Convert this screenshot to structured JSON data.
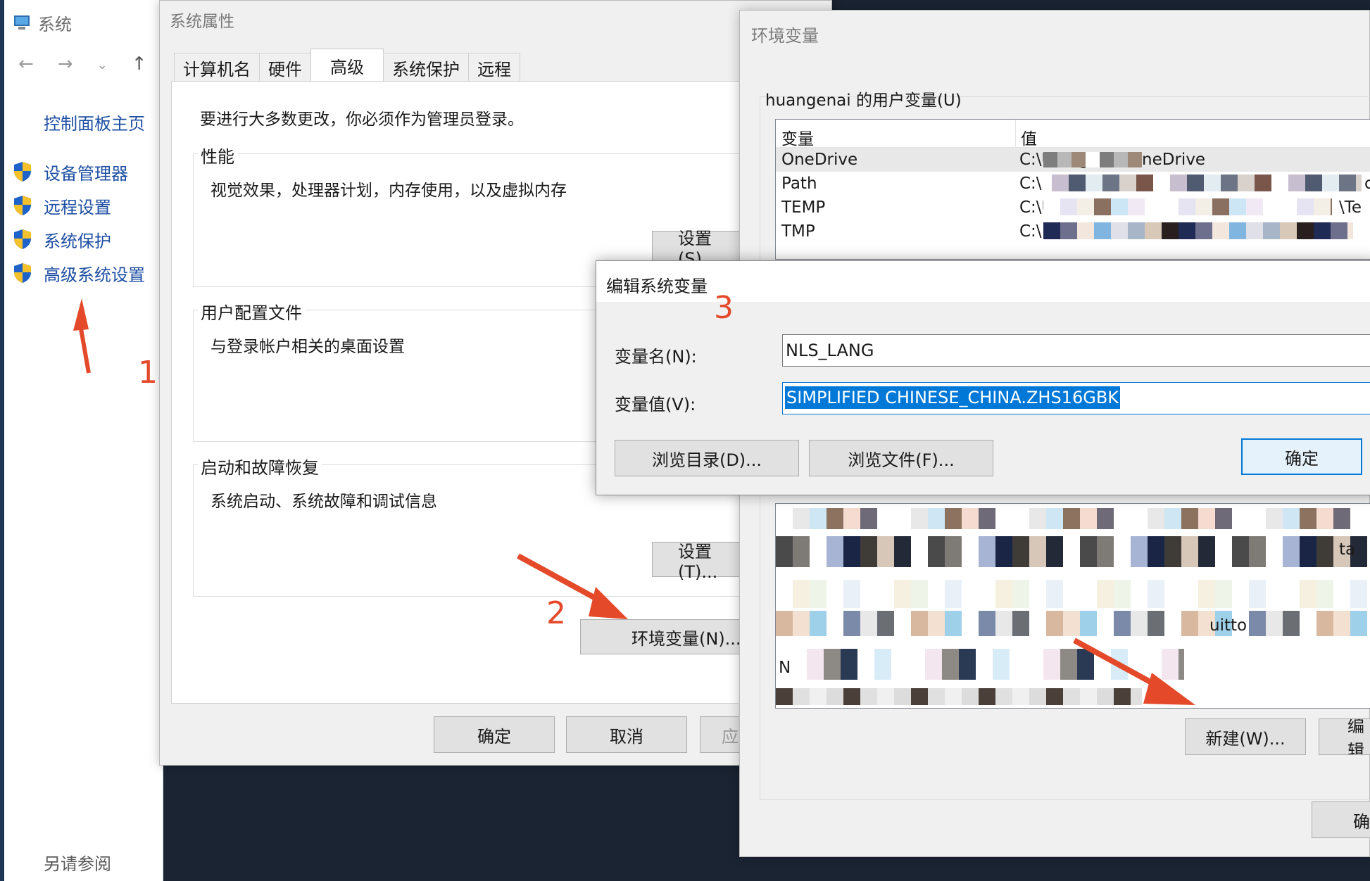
{
  "system_window": {
    "title": "系统",
    "nav": {
      "back": "←",
      "forward": "→",
      "recent": "⌄",
      "up": "↑"
    },
    "home_link": "控制面板主页",
    "links": [
      {
        "label": "设备管理器",
        "icon": "shield-icon"
      },
      {
        "label": "远程设置",
        "icon": "shield-icon"
      },
      {
        "label": "系统保护",
        "icon": "shield-icon"
      },
      {
        "label": "高级系统设置",
        "icon": "shield-icon"
      }
    ],
    "see_also": "另请参阅"
  },
  "system_properties": {
    "title": "系统属性",
    "tabs": [
      "计算机名",
      "硬件",
      "高级",
      "系统保护",
      "远程"
    ],
    "active_tab": "高级",
    "admin_note": "要进行大多数更改，你必须作为管理员登录。",
    "performance": {
      "label": "性能",
      "description": "视觉效果，处理器计划，内存使用，以及虚拟内存",
      "button": "设置(S)..."
    },
    "user_profiles": {
      "label": "用户配置文件",
      "description": "与登录帐户相关的桌面设置"
    },
    "startup_recovery": {
      "label": "启动和故障恢复",
      "description": "系统启动、系统故障和调试信息",
      "button": "设置(T)..."
    },
    "env_button": "环境变量(N)...",
    "ok": "确定",
    "cancel": "取消",
    "apply_partial": "应"
  },
  "env_vars": {
    "title": "环境变量",
    "user_section_label": "huangenai 的用户变量(U)",
    "columns": {
      "name": "变量",
      "value": "值"
    },
    "user_rows": [
      {
        "name": "OneDrive",
        "value": "C:\\U          angenai\\OneDrive"
      },
      {
        "name": "Path",
        "value": "C:\\"
      },
      {
        "name": "TEMP",
        "value": "C:\\U"
      },
      {
        "name": "TMP",
        "value": "C:\\"
      }
    ],
    "temp_suffix": "\\Te",
    "path_suffix": "c",
    "sys_row_fragments": {
      "a": "ta",
      "b": "uitto",
      "c": "N"
    },
    "new_button": "新建(W)...",
    "edit_button_partial": "编辑",
    "ok_partial": "确"
  },
  "edit_dialog": {
    "title": "编辑系统变量",
    "name_label": "变量名(N):",
    "name_value": "NLS_LANG",
    "value_label": "变量值(V):",
    "value_value": "SIMPLIFIED CHINESE_CHINA.ZHS16GBK",
    "browse_dir": "浏览目录(D)...",
    "browse_file": "浏览文件(F)...",
    "ok": "确定"
  },
  "annotations": {
    "step1": "1",
    "step2": "2",
    "step3": "3",
    "color": "#e4492a"
  },
  "colors": {
    "accent": "#0078d7",
    "link": "#1e4fa3",
    "dialog_bg": "#f0f0f0"
  }
}
